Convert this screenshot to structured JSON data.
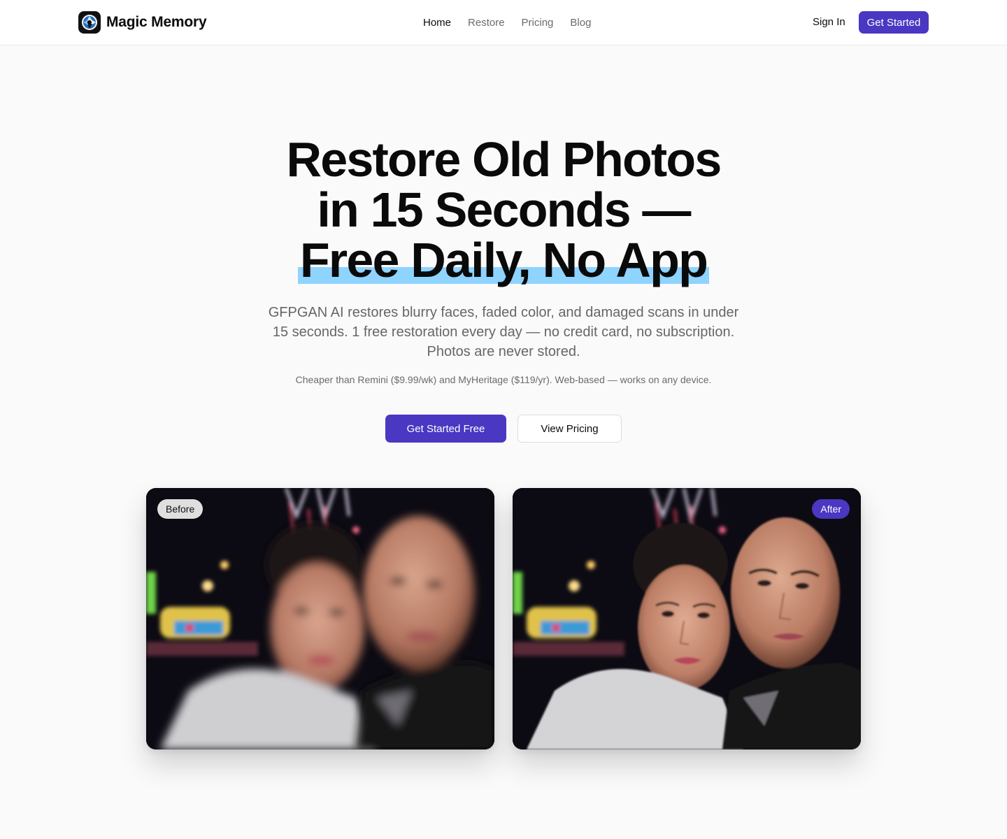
{
  "header": {
    "brand": "Magic Memory",
    "nav": [
      {
        "label": "Home",
        "active": true
      },
      {
        "label": "Restore",
        "active": false
      },
      {
        "label": "Pricing",
        "active": false
      },
      {
        "label": "Blog",
        "active": false
      }
    ],
    "sign_in": "Sign In",
    "cta": "Get Started"
  },
  "hero": {
    "title_line1": "Restore Old Photos",
    "title_line2": "in 15 Seconds —",
    "title_line3": "Free Daily, No App",
    "subtitle": "GFPGAN AI restores blurry faces, faded color, and damaged scans in under 15 seconds. 1 free restoration every day — no credit card, no subscription. Photos are never stored.",
    "note": "Cheaper than Remini ($9.99/wk) and MyHeritage ($119/yr). Web-based — works on any device.",
    "primary_button": "Get Started Free",
    "secondary_button": "View Pricing"
  },
  "comparison": {
    "before_label": "Before",
    "after_label": "After"
  },
  "colors": {
    "accent": "#4a37c2",
    "highlight": "#8fd3ff",
    "background": "#fafafa"
  },
  "icons": {
    "logo": "camera-aperture-icon"
  }
}
